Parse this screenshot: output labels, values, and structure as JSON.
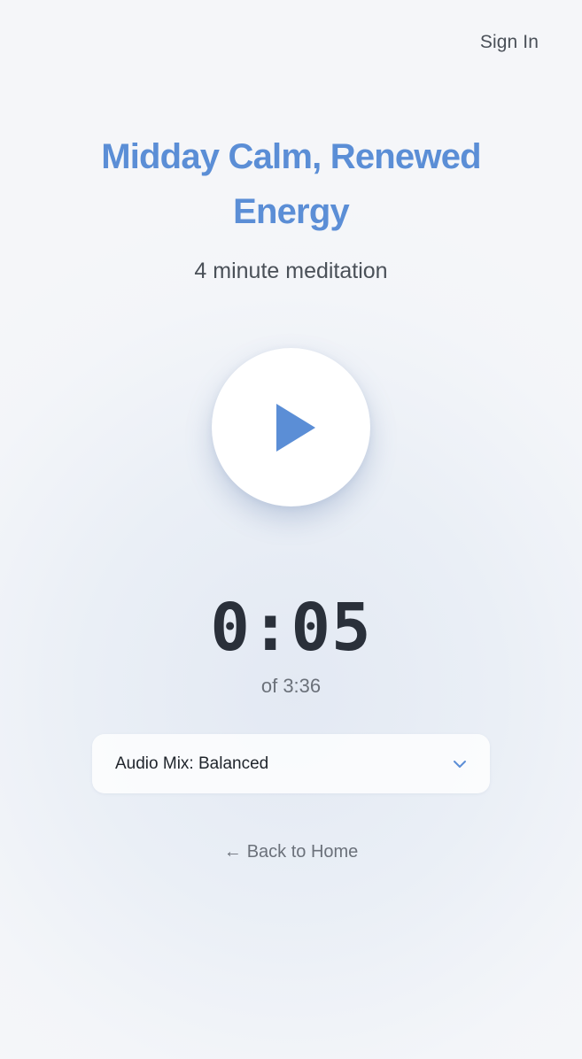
{
  "colors": {
    "accent": "#5b8ed6"
  },
  "header": {
    "sign_in_label": "Sign In"
  },
  "session": {
    "title": "Midday Calm, Renewed Energy",
    "subtitle": "4 minute meditation"
  },
  "player": {
    "play_icon": "play-icon",
    "elapsed": "0:05",
    "total_label": "of 3:36"
  },
  "audio_mix": {
    "selected_label": "Audio Mix: Balanced",
    "icon": "chevron-down-icon"
  },
  "navigation": {
    "back_arrow": "←",
    "back_label": "Back to Home"
  }
}
